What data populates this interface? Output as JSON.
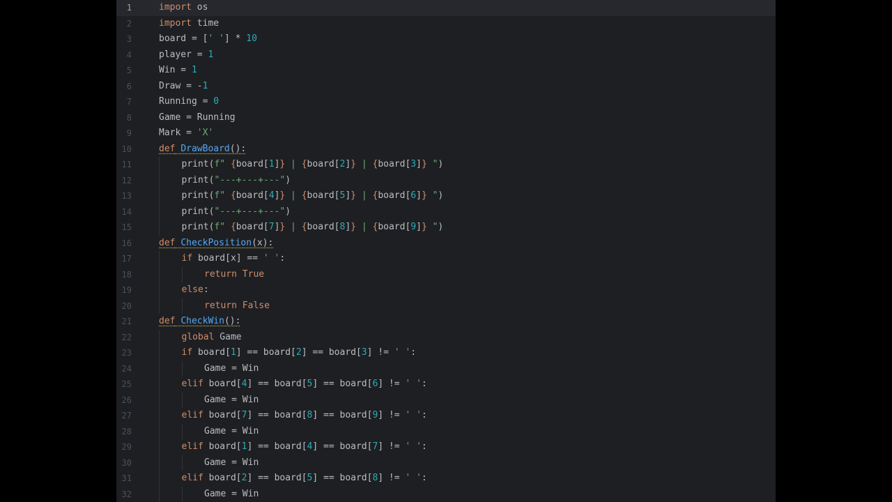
{
  "editor": {
    "current_line": 1,
    "colors": {
      "background": "#1e1f22",
      "keyword": "#cf8e6d",
      "number": "#2aacb8",
      "string": "#6aab73",
      "function": "#56a8f5",
      "text": "#bcbec4"
    },
    "lines": [
      {
        "n": "1",
        "indent": 0,
        "tokens": [
          {
            "t": "import",
            "c": "kw"
          },
          {
            "t": " os"
          }
        ]
      },
      {
        "n": "2",
        "indent": 0,
        "tokens": [
          {
            "t": "import",
            "c": "kw"
          },
          {
            "t": " time"
          }
        ]
      },
      {
        "n": "3",
        "indent": 0,
        "tokens": [
          {
            "t": "board = ["
          },
          {
            "t": "' '",
            "c": "str"
          },
          {
            "t": "] * "
          },
          {
            "t": "10",
            "c": "num"
          }
        ]
      },
      {
        "n": "4",
        "indent": 0,
        "tokens": [
          {
            "t": "player = "
          },
          {
            "t": "1",
            "c": "num"
          }
        ]
      },
      {
        "n": "5",
        "indent": 0,
        "tokens": [
          {
            "t": "Win = "
          },
          {
            "t": "1",
            "c": "num"
          }
        ]
      },
      {
        "n": "6",
        "indent": 0,
        "tokens": [
          {
            "t": "Draw = -"
          },
          {
            "t": "1",
            "c": "num"
          }
        ]
      },
      {
        "n": "7",
        "indent": 0,
        "tokens": [
          {
            "t": "Running = "
          },
          {
            "t": "0",
            "c": "num"
          }
        ]
      },
      {
        "n": "8",
        "indent": 0,
        "tokens": [
          {
            "t": "Game = Running"
          }
        ]
      },
      {
        "n": "9",
        "indent": 0,
        "tokens": [
          {
            "t": "Mark = "
          },
          {
            "t": "'X'",
            "c": "str"
          }
        ]
      },
      {
        "n": "10",
        "indent": 0,
        "tokens": [
          {
            "t": "def",
            "c": "kw warn"
          },
          {
            "t": " ",
            "c": "warn"
          },
          {
            "t": "DrawBoard",
            "c": "fn warn"
          },
          {
            "t": "():",
            "c": "warn"
          }
        ]
      },
      {
        "n": "11",
        "indent": 1,
        "tokens": [
          {
            "t": "print("
          },
          {
            "t": "f\" ",
            "c": "str"
          },
          {
            "t": "{",
            "c": "brace"
          },
          {
            "t": "board["
          },
          {
            "t": "1",
            "c": "num"
          },
          {
            "t": "]"
          },
          {
            "t": "}",
            "c": "brace"
          },
          {
            "t": " | ",
            "c": "str"
          },
          {
            "t": "{",
            "c": "brace"
          },
          {
            "t": "board["
          },
          {
            "t": "2",
            "c": "num"
          },
          {
            "t": "]"
          },
          {
            "t": "}",
            "c": "brace"
          },
          {
            "t": " | ",
            "c": "str"
          },
          {
            "t": "{",
            "c": "brace"
          },
          {
            "t": "board["
          },
          {
            "t": "3",
            "c": "num"
          },
          {
            "t": "]"
          },
          {
            "t": "}",
            "c": "brace"
          },
          {
            "t": " \"",
            "c": "str"
          },
          {
            "t": ")"
          }
        ]
      },
      {
        "n": "12",
        "indent": 1,
        "tokens": [
          {
            "t": "print("
          },
          {
            "t": "\"---+---+---\"",
            "c": "str"
          },
          {
            "t": ")"
          }
        ]
      },
      {
        "n": "13",
        "indent": 1,
        "tokens": [
          {
            "t": "print("
          },
          {
            "t": "f\" ",
            "c": "str"
          },
          {
            "t": "{",
            "c": "brace"
          },
          {
            "t": "board["
          },
          {
            "t": "4",
            "c": "num"
          },
          {
            "t": "]"
          },
          {
            "t": "}",
            "c": "brace"
          },
          {
            "t": " | ",
            "c": "str"
          },
          {
            "t": "{",
            "c": "brace"
          },
          {
            "t": "board["
          },
          {
            "t": "5",
            "c": "num"
          },
          {
            "t": "]"
          },
          {
            "t": "}",
            "c": "brace"
          },
          {
            "t": " | ",
            "c": "str"
          },
          {
            "t": "{",
            "c": "brace"
          },
          {
            "t": "board["
          },
          {
            "t": "6",
            "c": "num"
          },
          {
            "t": "]"
          },
          {
            "t": "}",
            "c": "brace"
          },
          {
            "t": " \"",
            "c": "str"
          },
          {
            "t": ")"
          }
        ]
      },
      {
        "n": "14",
        "indent": 1,
        "tokens": [
          {
            "t": "print("
          },
          {
            "t": "\"---+---+---\"",
            "c": "str"
          },
          {
            "t": ")"
          }
        ]
      },
      {
        "n": "15",
        "indent": 1,
        "tokens": [
          {
            "t": "print("
          },
          {
            "t": "f\" ",
            "c": "str"
          },
          {
            "t": "{",
            "c": "brace"
          },
          {
            "t": "board["
          },
          {
            "t": "7",
            "c": "num"
          },
          {
            "t": "]"
          },
          {
            "t": "}",
            "c": "brace"
          },
          {
            "t": " | ",
            "c": "str"
          },
          {
            "t": "{",
            "c": "brace"
          },
          {
            "t": "board["
          },
          {
            "t": "8",
            "c": "num"
          },
          {
            "t": "]"
          },
          {
            "t": "}",
            "c": "brace"
          },
          {
            "t": " | ",
            "c": "str"
          },
          {
            "t": "{",
            "c": "brace"
          },
          {
            "t": "board["
          },
          {
            "t": "9",
            "c": "num"
          },
          {
            "t": "]"
          },
          {
            "t": "}",
            "c": "brace"
          },
          {
            "t": " \"",
            "c": "str"
          },
          {
            "t": ")"
          }
        ]
      },
      {
        "n": "16",
        "indent": 0,
        "tokens": [
          {
            "t": "def",
            "c": "kw warn"
          },
          {
            "t": " ",
            "c": "warn"
          },
          {
            "t": "CheckPosition",
            "c": "fn warn"
          },
          {
            "t": "(x):",
            "c": "warn"
          }
        ]
      },
      {
        "n": "17",
        "indent": 1,
        "tokens": [
          {
            "t": "if",
            "c": "kw"
          },
          {
            "t": " board[x] == "
          },
          {
            "t": "' '",
            "c": "str"
          },
          {
            "t": ":"
          }
        ]
      },
      {
        "n": "18",
        "indent": 2,
        "tokens": [
          {
            "t": "return",
            "c": "kw"
          },
          {
            "t": " "
          },
          {
            "t": "True",
            "c": "kw"
          }
        ]
      },
      {
        "n": "19",
        "indent": 1,
        "tokens": [
          {
            "t": "else",
            "c": "kw"
          },
          {
            "t": ":"
          }
        ]
      },
      {
        "n": "20",
        "indent": 2,
        "tokens": [
          {
            "t": "return",
            "c": "kw"
          },
          {
            "t": " "
          },
          {
            "t": "False",
            "c": "kw"
          }
        ]
      },
      {
        "n": "21",
        "indent": 0,
        "tokens": [
          {
            "t": "def",
            "c": "kw warn"
          },
          {
            "t": " ",
            "c": "warn"
          },
          {
            "t": "CheckWin",
            "c": "fn warn"
          },
          {
            "t": "():",
            "c": "warn"
          }
        ]
      },
      {
        "n": "22",
        "indent": 1,
        "tokens": [
          {
            "t": "global",
            "c": "kw"
          },
          {
            "t": " Game"
          }
        ]
      },
      {
        "n": "23",
        "indent": 1,
        "tokens": [
          {
            "t": "if",
            "c": "kw"
          },
          {
            "t": " board["
          },
          {
            "t": "1",
            "c": "num"
          },
          {
            "t": "] == board["
          },
          {
            "t": "2",
            "c": "num"
          },
          {
            "t": "] == board["
          },
          {
            "t": "3",
            "c": "num"
          },
          {
            "t": "] != "
          },
          {
            "t": "' '",
            "c": "str"
          },
          {
            "t": ":"
          }
        ]
      },
      {
        "n": "24",
        "indent": 2,
        "tokens": [
          {
            "t": "Game = Win"
          }
        ]
      },
      {
        "n": "25",
        "indent": 1,
        "tokens": [
          {
            "t": "elif",
            "c": "kw"
          },
          {
            "t": " board["
          },
          {
            "t": "4",
            "c": "num"
          },
          {
            "t": "] == board["
          },
          {
            "t": "5",
            "c": "num"
          },
          {
            "t": "] == board["
          },
          {
            "t": "6",
            "c": "num"
          },
          {
            "t": "] != "
          },
          {
            "t": "' '",
            "c": "str"
          },
          {
            "t": ":"
          }
        ]
      },
      {
        "n": "26",
        "indent": 2,
        "tokens": [
          {
            "t": "Game = Win"
          }
        ]
      },
      {
        "n": "27",
        "indent": 1,
        "tokens": [
          {
            "t": "elif",
            "c": "kw"
          },
          {
            "t": " board["
          },
          {
            "t": "7",
            "c": "num"
          },
          {
            "t": "] == board["
          },
          {
            "t": "8",
            "c": "num"
          },
          {
            "t": "] == board["
          },
          {
            "t": "9",
            "c": "num"
          },
          {
            "t": "] != "
          },
          {
            "t": "' '",
            "c": "str"
          },
          {
            "t": ":"
          }
        ]
      },
      {
        "n": "28",
        "indent": 2,
        "tokens": [
          {
            "t": "Game = Win"
          }
        ]
      },
      {
        "n": "29",
        "indent": 1,
        "tokens": [
          {
            "t": "elif",
            "c": "kw"
          },
          {
            "t": " board["
          },
          {
            "t": "1",
            "c": "num"
          },
          {
            "t": "] == board["
          },
          {
            "t": "4",
            "c": "num"
          },
          {
            "t": "] == board["
          },
          {
            "t": "7",
            "c": "num"
          },
          {
            "t": "] != "
          },
          {
            "t": "' '",
            "c": "str"
          },
          {
            "t": ":"
          }
        ]
      },
      {
        "n": "30",
        "indent": 2,
        "tokens": [
          {
            "t": "Game = Win"
          }
        ]
      },
      {
        "n": "31",
        "indent": 1,
        "tokens": [
          {
            "t": "elif",
            "c": "kw"
          },
          {
            "t": " board["
          },
          {
            "t": "2",
            "c": "num"
          },
          {
            "t": "] == board["
          },
          {
            "t": "5",
            "c": "num"
          },
          {
            "t": "] == board["
          },
          {
            "t": "8",
            "c": "num"
          },
          {
            "t": "] != "
          },
          {
            "t": "' '",
            "c": "str"
          },
          {
            "t": ":"
          }
        ]
      },
      {
        "n": "32",
        "indent": 2,
        "tokens": [
          {
            "t": "Game = Win"
          }
        ]
      }
    ]
  }
}
